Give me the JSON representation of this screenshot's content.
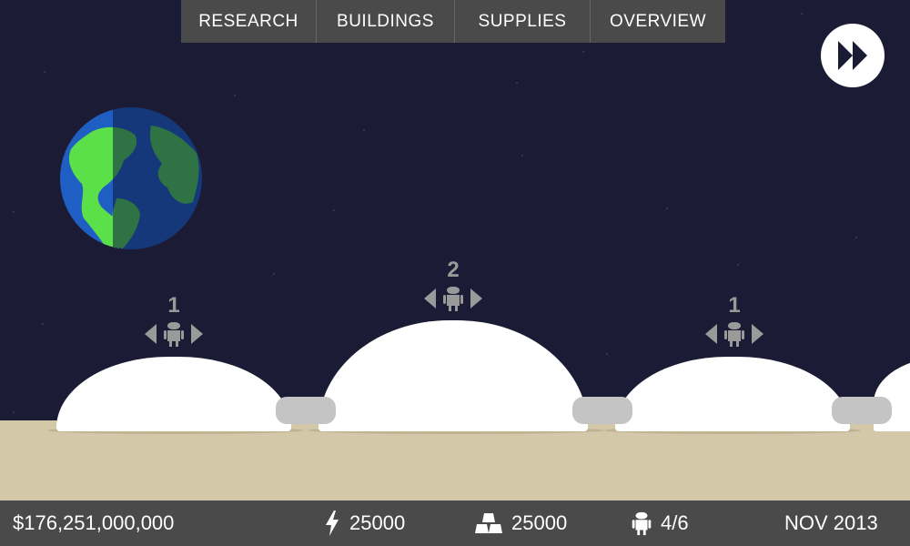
{
  "menu": {
    "tabs": [
      {
        "label": "RESEARCH"
      },
      {
        "label": "BUILDINGS"
      },
      {
        "label": "SUPPLIES"
      },
      {
        "label": "OVERVIEW"
      }
    ]
  },
  "controls": {
    "fast_forward_icon": "fast-forward-icon"
  },
  "domes": [
    {
      "population": "1"
    },
    {
      "population": "2"
    },
    {
      "population": "1"
    }
  ],
  "status": {
    "money": "$176,251,000,000",
    "energy": "25000",
    "materials": "25000",
    "robots": "4/6",
    "date": "NOV 2013"
  },
  "colors": {
    "sky": "#1b1b35",
    "ground": "#d3c9a8",
    "bar": "#4a4a4a",
    "icon_gray": "#9a9a9a"
  }
}
